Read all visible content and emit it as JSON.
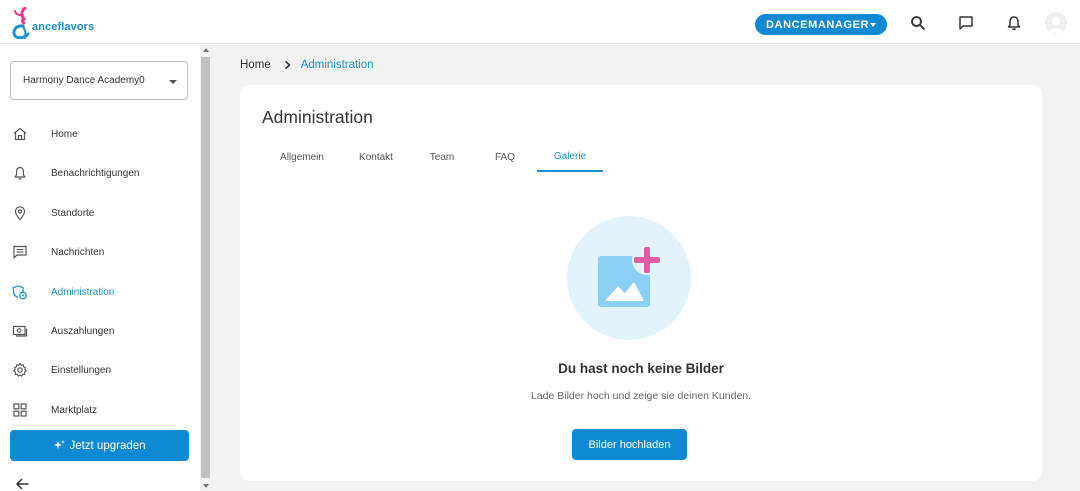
{
  "brand": {
    "logo_text": "anceflavors",
    "accent": "#0f8ad2",
    "logo_pink": "#e7398f",
    "logo_blue": "#1b8fd1"
  },
  "header": {
    "account_button": "DANCEMANAGER",
    "icons": [
      "search-icon",
      "chat-icon",
      "bell-icon",
      "avatar-icon"
    ]
  },
  "sidebar": {
    "academy": "Harmony Dance Academy0",
    "items": [
      {
        "label": "Home",
        "icon": "home-icon"
      },
      {
        "label": "Benachrichtigungen",
        "icon": "bell-icon"
      },
      {
        "label": "Standorte",
        "icon": "location-pin-icon"
      },
      {
        "label": "Nachrichten",
        "icon": "message-icon"
      },
      {
        "label": "Administration",
        "icon": "admin-icon",
        "active": true
      },
      {
        "label": "Auszahlungen",
        "icon": "payout-icon"
      },
      {
        "label": "Einstellungen",
        "icon": "gear-icon"
      },
      {
        "label": "Marktplatz",
        "icon": "grid-icon"
      }
    ],
    "upgrade_label": "Jetzt upgraden"
  },
  "breadcrumb": {
    "home": "Home",
    "current": "Administration"
  },
  "page": {
    "title": "Administration",
    "tabs": [
      {
        "label": "Allgemein"
      },
      {
        "label": "Kontakt"
      },
      {
        "label": "Team"
      },
      {
        "label": "FAQ"
      },
      {
        "label": "Galerie",
        "active": true
      }
    ],
    "empty_state": {
      "title": "Du hast noch keine Bilder",
      "subtitle": "Lade Bilder hoch und zeige sie deinen Kunden.",
      "button": "Bilder hochladen"
    }
  }
}
